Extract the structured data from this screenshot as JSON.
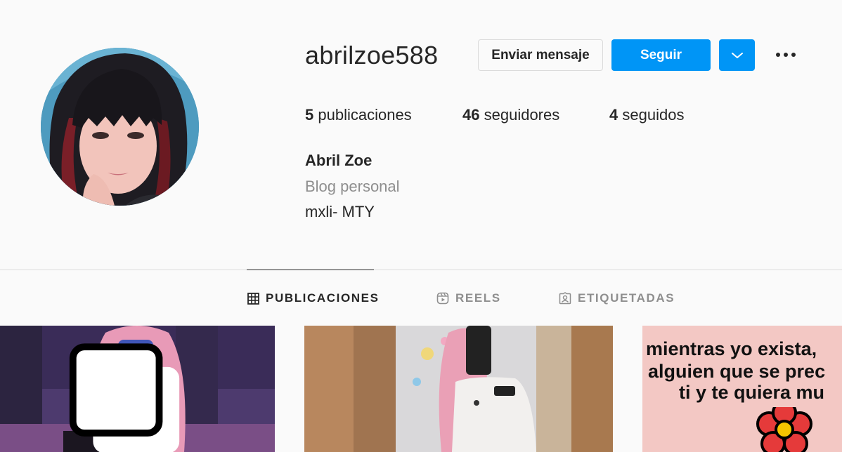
{
  "profile": {
    "username": "abrilzoe588",
    "full_name": "Abril Zoe",
    "category": "Blog personal",
    "bio": "mxli- MTY"
  },
  "actions": {
    "message_label": "Enviar mensaje",
    "follow_label": "Seguir",
    "dropdown_icon": "chevron-down-icon",
    "more_icon": "more-options-icon"
  },
  "stats": {
    "posts": {
      "count": "5",
      "label": "publicaciones"
    },
    "followers": {
      "count": "46",
      "label": "seguidores"
    },
    "following": {
      "count": "4",
      "label": "seguidos"
    }
  },
  "tabs": [
    {
      "label": "PUBLICACIONES",
      "icon": "grid-icon",
      "active": true
    },
    {
      "label": "REELS",
      "icon": "reels-icon",
      "active": false
    },
    {
      "label": "ETIQUETADAS",
      "icon": "tagged-icon",
      "active": false
    }
  ],
  "posts": [
    {
      "type": "photo",
      "multiple": true
    },
    {
      "type": "photo",
      "multiple": false
    },
    {
      "type": "text-image",
      "lines": [
        "mientras yo exista,",
        "alguien que se prec",
        "ti y te quiera mu"
      ]
    }
  ],
  "colors": {
    "accent": "#0095f6",
    "background": "#fafafa",
    "text": "#262626",
    "muted": "#8e8e8e",
    "border": "#dbdbdb"
  }
}
